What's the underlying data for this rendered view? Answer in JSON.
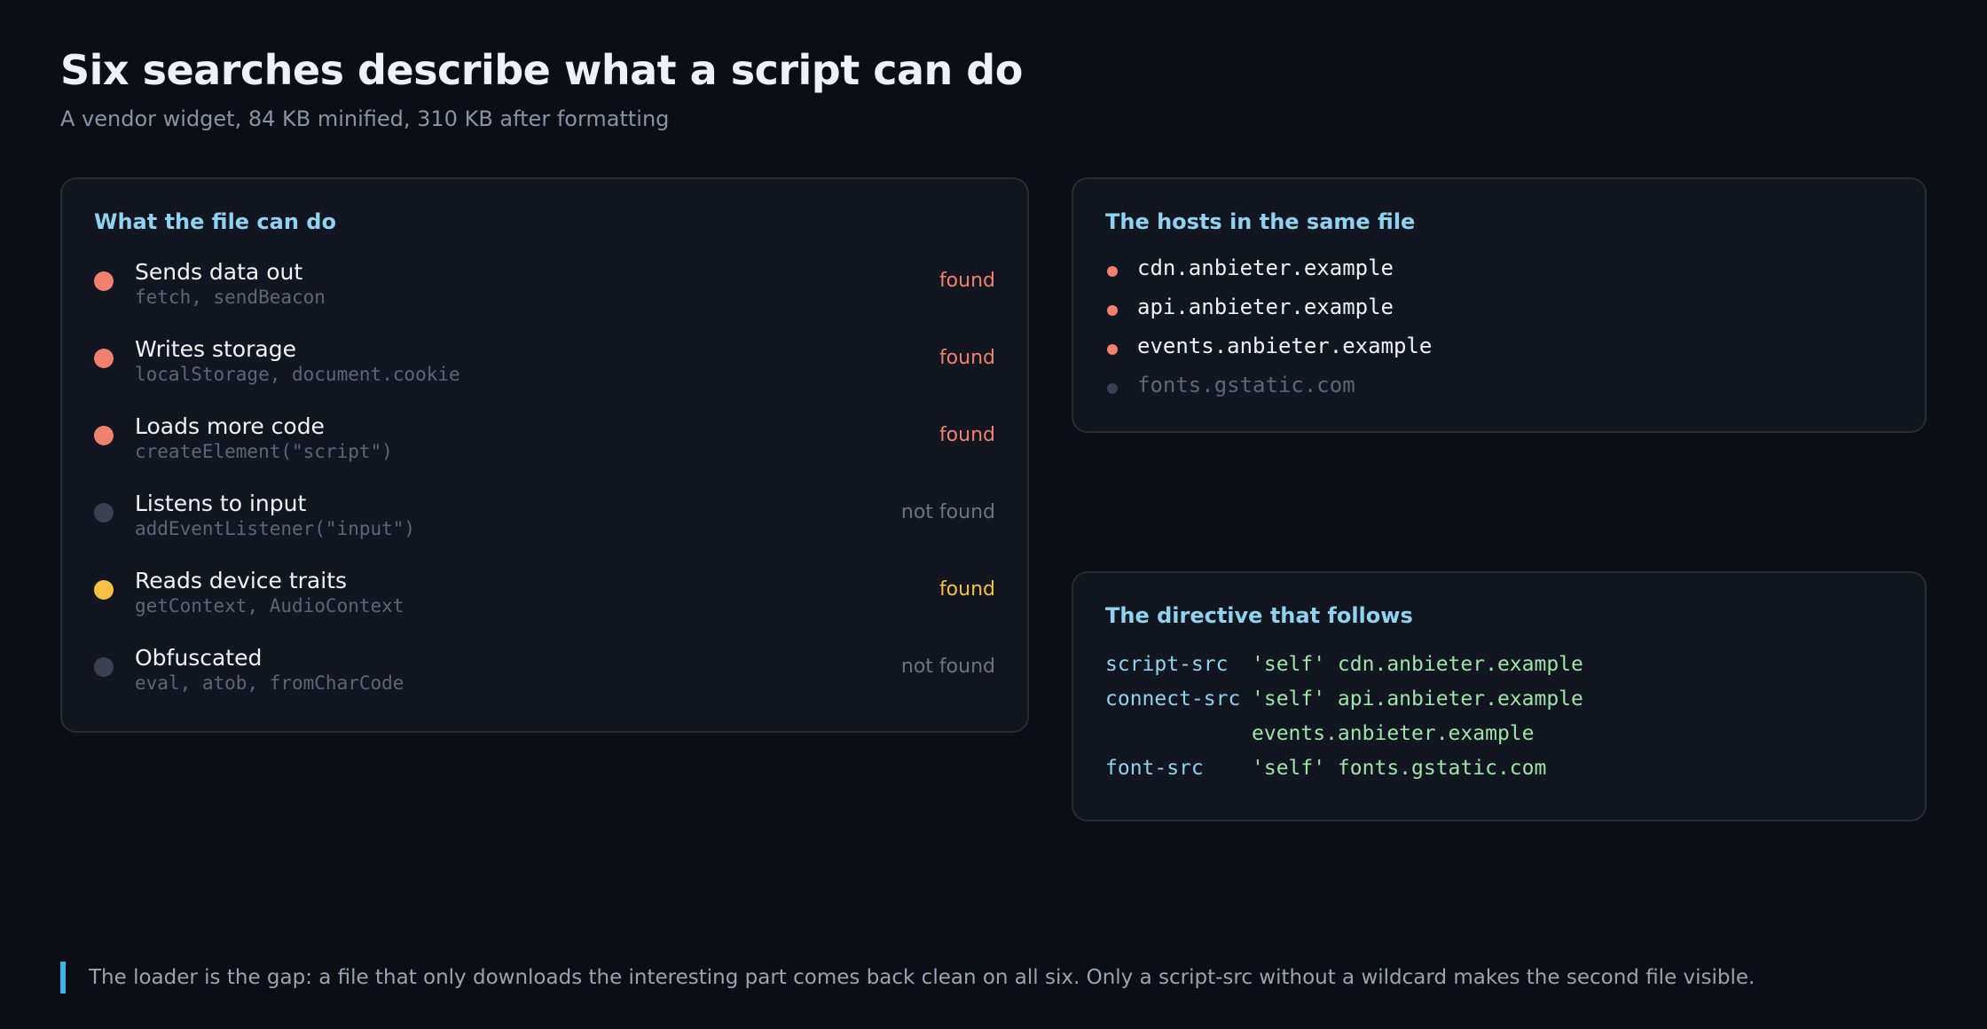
{
  "header": {
    "title": "Six searches describe what a script can do",
    "subtitle": "A vendor widget, 84 KB minified, 310 KB after formatting"
  },
  "capabilities": {
    "heading": "What the file can do",
    "items": [
      {
        "label": "Sends data out",
        "code": "fetch, sendBeacon",
        "status": "found",
        "color": "#f0806f"
      },
      {
        "label": "Writes storage",
        "code": "localStorage, document.cookie",
        "status": "found",
        "color": "#f0806f"
      },
      {
        "label": "Loads more code",
        "code": "createElement(\"script\")",
        "status": "found",
        "color": "#f0806f"
      },
      {
        "label": "Listens to input",
        "code": "addEventListener(\"input\")",
        "status": "not found",
        "color": "#3a4150"
      },
      {
        "label": "Reads device traits",
        "code": "getContext, AudioContext",
        "status": "found",
        "color": "#f6c042"
      },
      {
        "label": "Obfuscated",
        "code": "eval, atob, fromCharCode",
        "status": "not found",
        "color": "#3a4150"
      }
    ]
  },
  "hosts": {
    "heading": "The hosts in the same file",
    "items": [
      {
        "name": "cdn.anbieter.example",
        "color": "#f0806f",
        "text_color": "#eef1f6"
      },
      {
        "name": "api.anbieter.example",
        "color": "#f0806f",
        "text_color": "#eef1f6"
      },
      {
        "name": "events.anbieter.example",
        "color": "#f0806f",
        "text_color": "#eef1f6"
      },
      {
        "name": "fonts.gstatic.com",
        "color": "#3a4150",
        "text_color": "#5d6676"
      }
    ]
  },
  "directive": {
    "heading": "The directive that follows",
    "lines": [
      {
        "key": "script-src",
        "value": "'self' cdn.anbieter.example"
      },
      {
        "key": "connect-src",
        "value": "'self' api.anbieter.example"
      },
      {
        "key": "",
        "value": "events.anbieter.example"
      },
      {
        "key": "font-src",
        "value": "'self' fonts.gstatic.com"
      }
    ]
  },
  "footer": {
    "note": "The loader is the gap: a file that only downloads the interesting part comes back clean on all six. Only a script-src without a wildcard makes the second file visible."
  },
  "colors": {
    "found_red": "#f0806f",
    "found_yellow": "#f6c042",
    "not_found": "#6b7384",
    "accent": "#8fd3f0",
    "directive_value": "#9fe3a8",
    "footer_bar": "#3fb3e6"
  }
}
